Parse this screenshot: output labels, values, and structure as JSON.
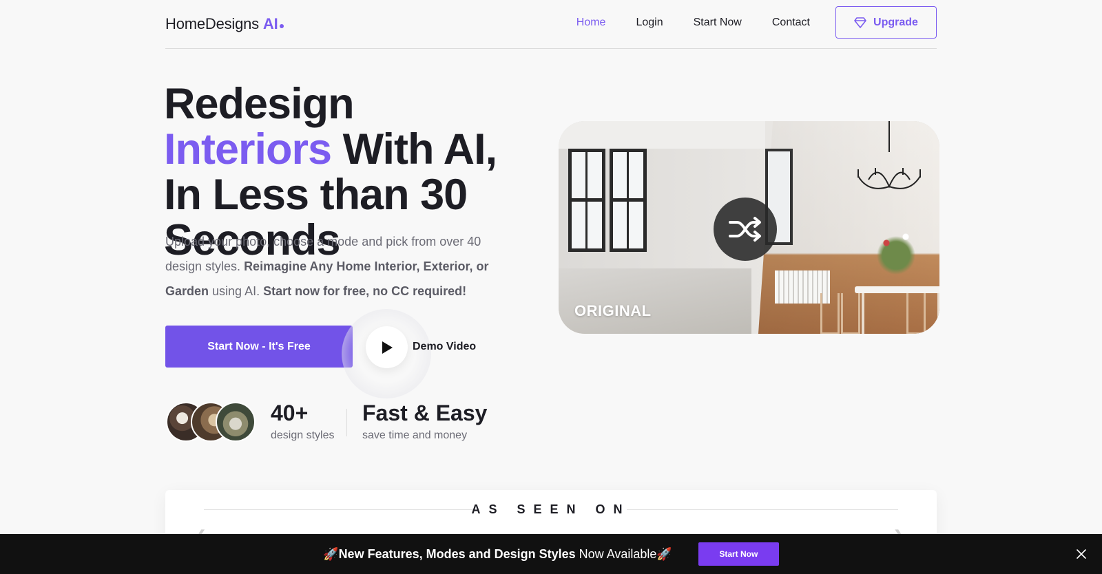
{
  "nav": {
    "logo_text": "HomeDesigns",
    "logo_accent": "AI",
    "links": [
      {
        "label": "Home",
        "active": true
      },
      {
        "label": "Login"
      },
      {
        "label": "Start Now"
      },
      {
        "label": "Contact"
      }
    ],
    "upgrade_label": "Upgrade",
    "upgrade_icon": "diamond-icon"
  },
  "hero": {
    "title_part1": "Redesign ",
    "title_accent": "Interiors",
    "title_part2": "With AI, In Less than 30 Seconds",
    "desc_plain1": "Upload your photo, choose a mode and pick from over 40 design styles. ",
    "desc_bold1": "Reimagine Any Home Interior, Exterior, or Garden",
    "desc_plain2": " using AI. ",
    "desc_bold2": "Start now for free, no CC required!",
    "cta_label": "Start Now - It's Free",
    "demo_label": "Demo Video"
  },
  "stats": [
    {
      "value": "40+",
      "label": "design styles"
    },
    {
      "value": "Fast & Easy",
      "label": "save time and money"
    }
  ],
  "compare": {
    "original_label": "ORIGINAL",
    "shuffle_icon": "shuffle-icon"
  },
  "seen_on": {
    "title": "AS SEEN ON"
  },
  "banner": {
    "emoji_left": "🚀",
    "bold_text": "New Features, Modes and Design Styles",
    "plain_text": " Now Available",
    "emoji_right": "🚀",
    "button_label": "Start Now",
    "close_icon": "close-icon"
  },
  "colors": {
    "accent": "#7b5cf0",
    "cta": "#7253e8",
    "banner_bg": "#111111",
    "banner_btn": "#7a3cf0"
  }
}
